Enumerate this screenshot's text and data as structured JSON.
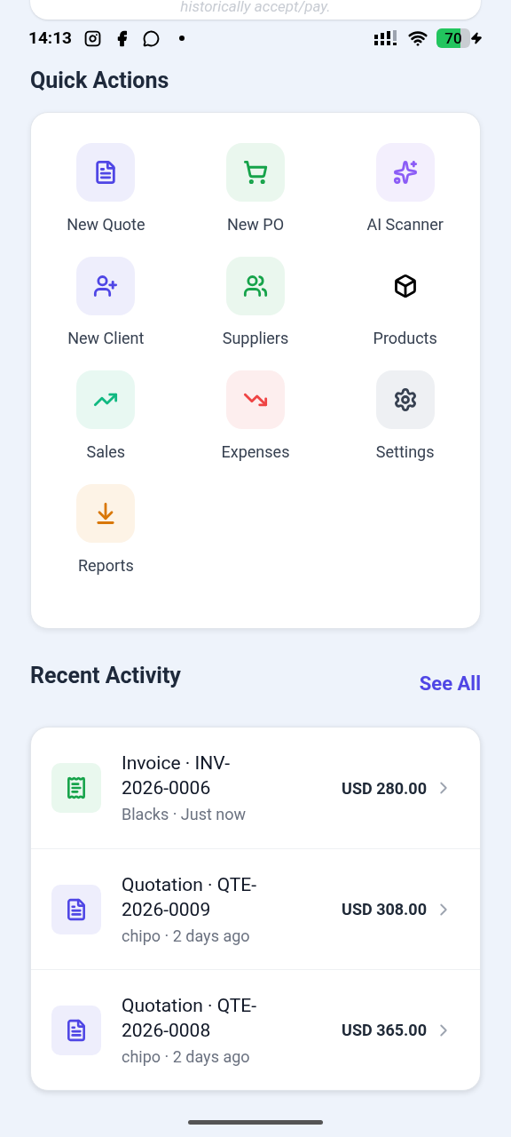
{
  "top_card": {
    "note": "historically accept/pay."
  },
  "status_bar": {
    "time": "14:13",
    "battery": {
      "text": "70",
      "level": 0.7,
      "charging": true
    }
  },
  "quick_actions": {
    "title": "Quick Actions",
    "items": [
      {
        "label": "New Quote",
        "kind": "quote"
      },
      {
        "label": "New PO",
        "kind": "cart"
      },
      {
        "label": "AI Scanner",
        "kind": "scanner"
      },
      {
        "label": "New Client",
        "kind": "client"
      },
      {
        "label": "Suppliers",
        "kind": "suppliers"
      },
      {
        "label": "Products",
        "kind": "products"
      },
      {
        "label": "Sales",
        "kind": "sales"
      },
      {
        "label": "Expenses",
        "kind": "expenses"
      },
      {
        "label": "Settings",
        "kind": "settings"
      },
      {
        "label": "Reports",
        "kind": "reports"
      }
    ]
  },
  "recent_activity": {
    "title": "Recent Activity",
    "see_all": "See All",
    "items": [
      {
        "kind": "invoice",
        "title": "Invoice · INV-2026-0006",
        "subtitle": "Blacks · Just now",
        "amount": "USD 280.00"
      },
      {
        "kind": "quotation",
        "title": "Quotation · QTE-2026-0009",
        "subtitle": "chipo · 2 days ago",
        "amount": "USD 308.00"
      },
      {
        "kind": "quotation",
        "title": "Quotation · QTE-2026-0008",
        "subtitle": "chipo · 2 days ago",
        "amount": "USD 365.00"
      }
    ]
  }
}
